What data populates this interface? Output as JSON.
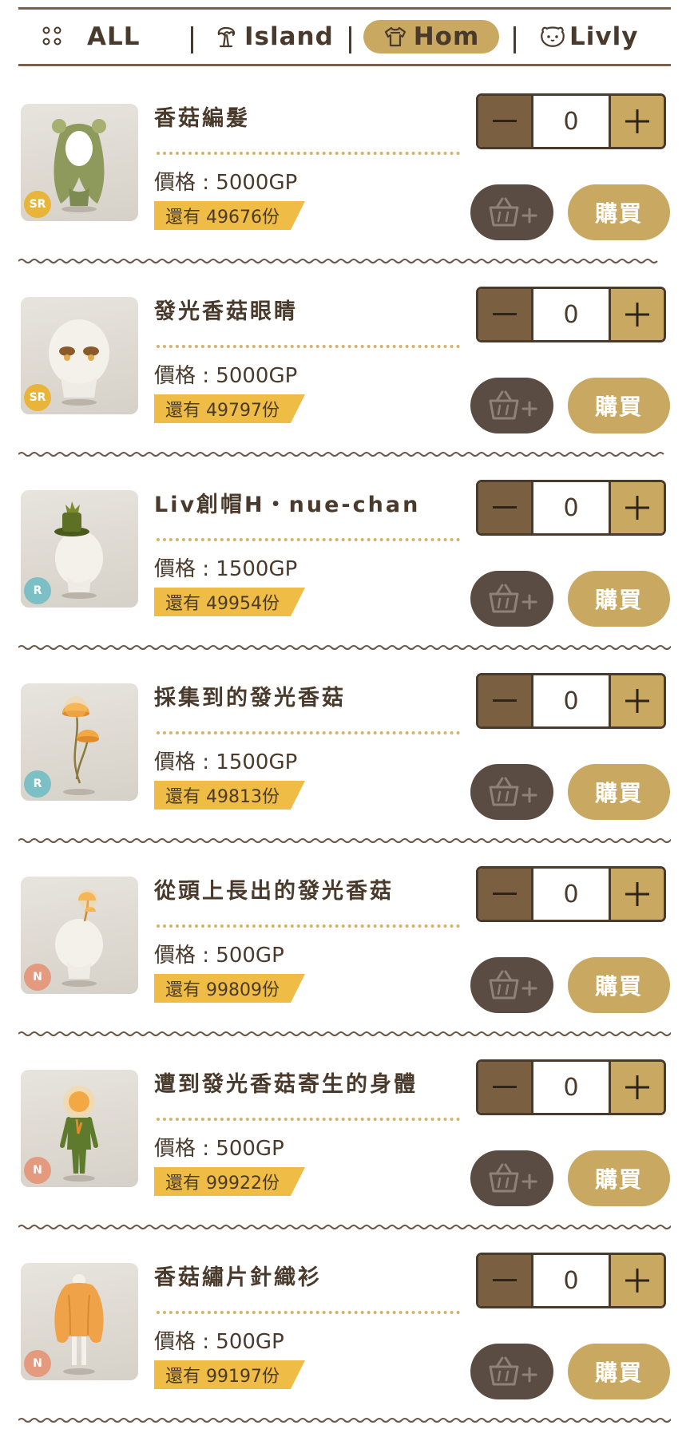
{
  "tabs": {
    "all": "ALL",
    "island": "Island",
    "home": "Hom",
    "livly": "Livly",
    "active": "home"
  },
  "items": [
    {
      "name": "香菇編髮",
      "price": "價格 : 5000GP",
      "stock": "還有 49676份",
      "rarity": "SR",
      "qty": "0",
      "buy": "購買",
      "icon": "hair-icon"
    },
    {
      "name": "發光香菇眼睛",
      "price": "價格 : 5000GP",
      "stock": "還有 49797份",
      "rarity": "SR",
      "qty": "0",
      "buy": "購買",
      "icon": "eyes-icon"
    },
    {
      "name": "Liv創帽H・nue-chan",
      "price": "價格 : 1500GP",
      "stock": "還有 49954份",
      "rarity": "R",
      "qty": "0",
      "buy": "購買",
      "icon": "hat-icon"
    },
    {
      "name": "採集到的發光香菇",
      "price": "價格 : 1500GP",
      "stock": "還有 49813份",
      "rarity": "R",
      "qty": "0",
      "buy": "購買",
      "icon": "mushroom-icon"
    },
    {
      "name": "從頭上長出的發光香菇",
      "price": "價格 : 500GP",
      "stock": "還有 99809份",
      "rarity": "N",
      "qty": "0",
      "buy": "購買",
      "icon": "head-mushroom-icon"
    },
    {
      "name": "遭到發光香菇寄生的身體",
      "price": "價格 : 500GP",
      "stock": "還有 99922份",
      "rarity": "N",
      "qty": "0",
      "buy": "購買",
      "icon": "body-icon"
    },
    {
      "name": "香菇繡片針織衫",
      "price": "價格 : 500GP",
      "stock": "還有 99197份",
      "rarity": "N",
      "qty": "0",
      "buy": "購買",
      "icon": "sweater-icon"
    }
  ],
  "colors": {
    "accent": "#c9a862",
    "dark": "#4a3a2c",
    "stock_label": "#efbd46",
    "cart_button": "#5a4c42"
  }
}
